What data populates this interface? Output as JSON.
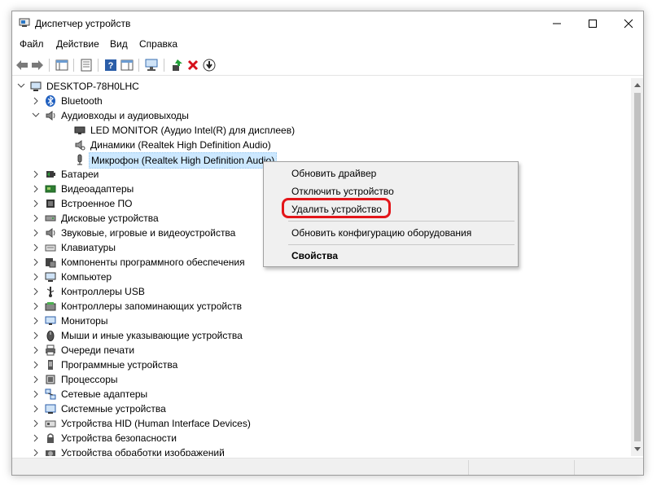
{
  "window": {
    "title": "Диспетчер устройств",
    "controls": {
      "minimize": "—",
      "maximize": "☐",
      "close": "✕"
    }
  },
  "menu": [
    "Файл",
    "Действие",
    "Вид",
    "Справка"
  ],
  "tree": {
    "root": "DESKTOP-78H0LHC",
    "items": [
      {
        "label": "Bluetooth",
        "icon": "bluetooth-icon",
        "expanded": false
      },
      {
        "label": "Аудиовходы и аудиовыходы",
        "icon": "audio-io-icon",
        "expanded": true,
        "children": [
          {
            "label": "LED MONITOR (Аудио Intel(R) для дисплеев)",
            "icon": "monitor-icon"
          },
          {
            "label": "Динамики (Realtek High Definition Audio)",
            "icon": "speaker-icon"
          },
          {
            "label": "Микрофон (Realtek High Definition Audio)",
            "icon": "microphone-icon",
            "selected": true
          }
        ]
      },
      {
        "label": "Батареи",
        "icon": "battery-icon",
        "expanded": false
      },
      {
        "label": "Видеоадаптеры",
        "icon": "video-adapter-icon",
        "expanded": false
      },
      {
        "label": "Встроенное ПО",
        "icon": "firmware-icon",
        "expanded": false
      },
      {
        "label": "Дисковые устройства",
        "icon": "disk-icon",
        "expanded": false
      },
      {
        "label": "Звуковые, игровые и видеоустройства",
        "icon": "sound-icon",
        "expanded": false
      },
      {
        "label": "Клавиатуры",
        "icon": "keyboard-icon",
        "expanded": false
      },
      {
        "label": "Компоненты программного обеспечения",
        "icon": "software-component-icon",
        "expanded": false
      },
      {
        "label": "Компьютер",
        "icon": "computer-icon",
        "expanded": false
      },
      {
        "label": "Контроллеры USB",
        "icon": "usb-icon",
        "expanded": false
      },
      {
        "label": "Контроллеры запоминающих устройств",
        "icon": "storage-controller-icon",
        "expanded": false
      },
      {
        "label": "Мониторы",
        "icon": "monitor-icon",
        "expanded": false
      },
      {
        "label": "Мыши и иные указывающие устройства",
        "icon": "mouse-icon",
        "expanded": false
      },
      {
        "label": "Очереди печати",
        "icon": "printer-icon",
        "expanded": false
      },
      {
        "label": "Программные устройства",
        "icon": "software-device-icon",
        "expanded": false
      },
      {
        "label": "Процессоры",
        "icon": "processor-icon",
        "expanded": false
      },
      {
        "label": "Сетевые адаптеры",
        "icon": "network-adapter-icon",
        "expanded": false
      },
      {
        "label": "Системные устройства",
        "icon": "system-device-icon",
        "expanded": false
      },
      {
        "label": "Устройства HID (Human Interface Devices)",
        "icon": "hid-icon",
        "expanded": false
      },
      {
        "label": "Устройства безопасности",
        "icon": "security-device-icon",
        "expanded": false
      },
      {
        "label": "Устройства обработки изображений",
        "icon": "imaging-device-icon",
        "expanded": false
      }
    ]
  },
  "context_menu": {
    "items": [
      {
        "label": "Обновить драйвер"
      },
      {
        "label": "Отключить устройство"
      },
      {
        "label": "Удалить устройство",
        "highlighted": true
      },
      {
        "label": "Обновить конфигурацию оборудования"
      },
      {
        "label": "Свойства",
        "bold": true
      }
    ]
  },
  "colors": {
    "selection": "#cce8ff",
    "highlight_border": "#e3161a",
    "menu_bg": "#f0f0f0"
  }
}
